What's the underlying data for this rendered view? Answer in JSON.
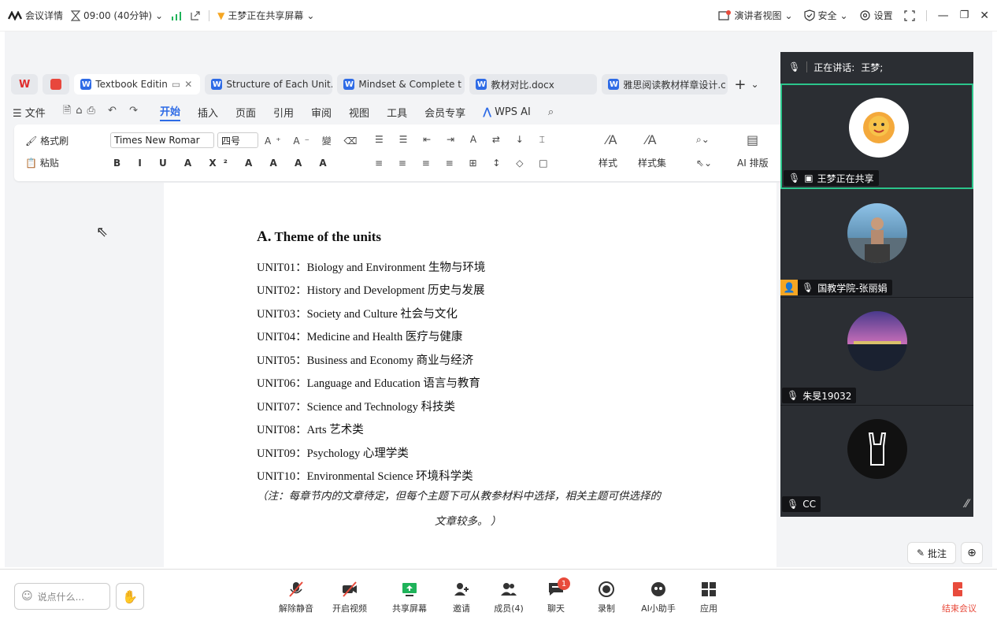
{
  "topbar": {
    "meeting_details": "会议详情",
    "time": "09:00 (40分钟)",
    "sharing_status": "王梦正在共享屏幕",
    "presenter_view": "演讲者视图",
    "security": "安全",
    "settings": "设置"
  },
  "wps": {
    "tabs": [
      {
        "label": "Textbook Editin"
      },
      {
        "label": "Structure of Each Unit."
      },
      {
        "label": "Mindset & Complete t"
      },
      {
        "label": "教材对比.docx"
      },
      {
        "label": "雅思阅读教材样章设计.c"
      }
    ],
    "menu": {
      "file": "文件",
      "start": "开始",
      "insert": "插入",
      "page": "页面",
      "reference": "引用",
      "review": "审阅",
      "view": "视图",
      "tools": "工具",
      "member": "会员专享",
      "wps_ai": "WPS AI"
    },
    "ribbon": {
      "format_painter": "格式刷",
      "paste": "粘贴",
      "font_name": "Times New Romar",
      "font_size": "四号",
      "styles": "样式",
      "style_set": "样式集",
      "ai_layout": "AI 排版"
    }
  },
  "document": {
    "heading_letter": "A.",
    "heading_text": "Theme of the units",
    "units": [
      "UNIT01：Biology and Environment 生物与环境",
      "UNIT02：History and Development 历史与发展",
      "UNIT03：Society and Culture 社会与文化",
      "UNIT04：Medicine and Health 医疗与健康",
      "UNIT05：Business and Economy 商业与经济",
      "UNIT06：Language and Education 语言与教育",
      "UNIT07：Science and Technology 科技类",
      "UNIT08：Arts 艺术类",
      "UNIT09：Psychology 心理学类",
      "UNIT10：Environmental Science 环境科学类"
    ],
    "note_line1": "（注：每章节内的文章待定，但每个主题下可从教参材料中选择，相关主题可供选择的",
    "note_line2": "文章较多。 ）"
  },
  "video_panel": {
    "speaking_label": "正在讲话:",
    "speaking_name": "王梦;",
    "participants": [
      {
        "name": "王梦正在共享"
      },
      {
        "name": "国教学院-张丽娟"
      },
      {
        "name": "朱旻19032"
      },
      {
        "name": "CC"
      }
    ]
  },
  "bottombar": {
    "say_placeholder": "说点什么...",
    "unmute": "解除静音",
    "start_video": "开启视频",
    "share_screen": "共享屏幕",
    "invite": "邀请",
    "members": "成员(4)",
    "chat": "聊天",
    "chat_badge": "1",
    "record": "录制",
    "ai_assistant": "AI小助手",
    "apps": "应用",
    "end_meeting": "结束会议",
    "annotate": "批注"
  }
}
